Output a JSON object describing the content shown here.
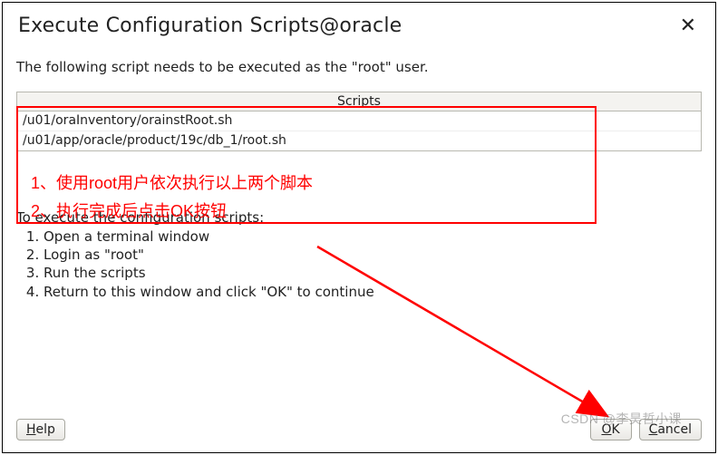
{
  "window": {
    "title": "Execute Configuration Scripts@oracle",
    "close_icon": "✕"
  },
  "intro": "The following script needs to be executed as the \"root\" user.",
  "scripts": {
    "header": "Scripts",
    "rows": [
      "/u01/oraInventory/orainstRoot.sh",
      "/u01/app/oracle/product/19c/db_1/root.sh"
    ]
  },
  "annotation": {
    "line1": "1、使用root用户依次执行以上两个脚本",
    "line2": "2、执行完成后点击OK按钮"
  },
  "instructions": {
    "head": "To execute the configuration scripts:",
    "items": [
      "Open a terminal window",
      "Login as \"root\"",
      "Run the scripts",
      "Return to this window and click \"OK\" to continue"
    ]
  },
  "buttons": {
    "help": "Help",
    "ok": "OK",
    "cancel": "Cancel"
  },
  "watermark": "CSDN @李昊哲小课"
}
